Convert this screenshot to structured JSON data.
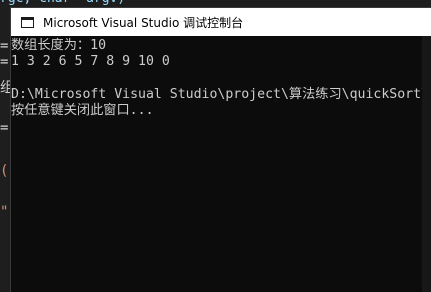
{
  "editor": {
    "top_code": "rgc, char* argv)",
    "frags": [
      {
        "text": "=",
        "color": "#d4d4d4"
      },
      {
        "text": "=",
        "color": "#d4d4d4"
      },
      {
        "text": "组",
        "color": "#d4d4d4"
      },
      {
        "text": "=(",
        "color": "#d4d4d4"
      },
      {
        "text": "(\"",
        "color": "#ce9178"
      },
      {
        "text": "\")",
        "color": "#ce9178"
      }
    ]
  },
  "console": {
    "title": "Microsoft Visual Studio 调试控制台",
    "lines": [
      "数组长度为：10",
      "1 3 2 6 5 7 8 9 10 0",
      "",
      "D:\\Microsoft Visual Studio\\project\\算法练习\\quickSort\\Debug\\quickSort.exe",
      "按任意键关闭此窗口..."
    ]
  }
}
